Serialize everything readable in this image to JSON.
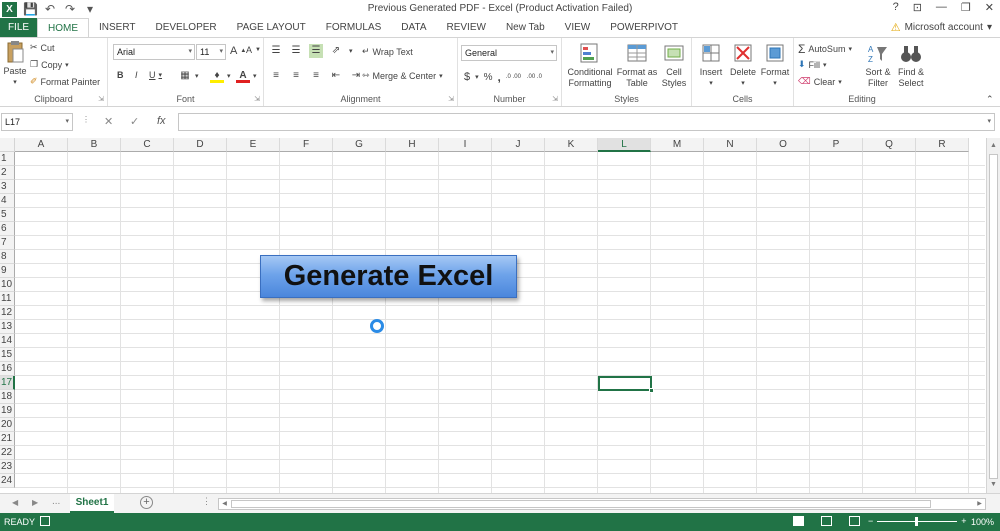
{
  "titlebar": {
    "title": "Previous Generated PDF - Excel (Product Activation Failed)",
    "app_logo": "X",
    "qat_icons": [
      "save-icon",
      "undo-icon",
      "redo-icon",
      "customize-icon"
    ],
    "window_controls": [
      "?",
      "⊡",
      "—",
      "❐",
      "✕"
    ]
  },
  "tabs": {
    "file": "FILE",
    "items": [
      "HOME",
      "INSERT",
      "DEVELOPER",
      "PAGE LAYOUT",
      "FORMULAS",
      "DATA",
      "REVIEW",
      "New Tab",
      "VIEW",
      "POWERPIVOT"
    ],
    "active": "HOME",
    "account": "Microsoft account"
  },
  "ribbon": {
    "clipboard": {
      "label": "Clipboard",
      "paste": "Paste",
      "cut": "Cut",
      "copy": "Copy",
      "format_painter": "Format Painter"
    },
    "font": {
      "label": "Font",
      "font_name": "Arial",
      "font_size": "11",
      "bold": "B",
      "italic": "I",
      "underline": "U",
      "grow": "A",
      "shrink": "A",
      "font_color": "A"
    },
    "alignment": {
      "label": "Alignment",
      "wrap_text": "Wrap Text",
      "merge_center": "Merge & Center"
    },
    "number": {
      "label": "Number",
      "format": "General",
      "currency": "$",
      "percent": "%",
      "comma": ",",
      "inc_decimal": ".0 .00",
      "dec_decimal": ".00 .0"
    },
    "styles": {
      "label": "Styles",
      "conditional": "Conditional Formatting",
      "format_table": "Format as Table",
      "cell_styles": "Cell Styles"
    },
    "cells": {
      "label": "Cells",
      "insert": "Insert",
      "delete": "Delete",
      "format": "Format"
    },
    "editing": {
      "label": "Editing",
      "autosum": "AutoSum",
      "fill": "Fill",
      "clear": "Clear",
      "sort_filter": "Sort & Filter",
      "find_select": "Find & Select"
    }
  },
  "formula_bar": {
    "name_box": "L17",
    "cancel": "✕",
    "enter": "✓",
    "fx": "fx",
    "value": ""
  },
  "grid": {
    "columns": [
      "A",
      "B",
      "C",
      "D",
      "E",
      "F",
      "G",
      "H",
      "I",
      "J",
      "K",
      "L",
      "M",
      "N",
      "O",
      "P",
      "Q",
      "R"
    ],
    "rows": [
      "1",
      "2",
      "3",
      "4",
      "5",
      "6",
      "7",
      "8",
      "9",
      "10",
      "11",
      "12",
      "13",
      "14",
      "15",
      "16",
      "17",
      "18",
      "19",
      "20",
      "21",
      "22",
      "23",
      "24"
    ],
    "selected_column": "L",
    "selected_row": "17"
  },
  "button": {
    "label": "Generate Excel"
  },
  "sheets": {
    "ellipsis": "...",
    "active": "Sheet1",
    "add": "+"
  },
  "status": {
    "ready": "READY",
    "zoom": "100%"
  },
  "colors": {
    "excel_green": "#217346",
    "button_blue": "#6ea3ea"
  }
}
